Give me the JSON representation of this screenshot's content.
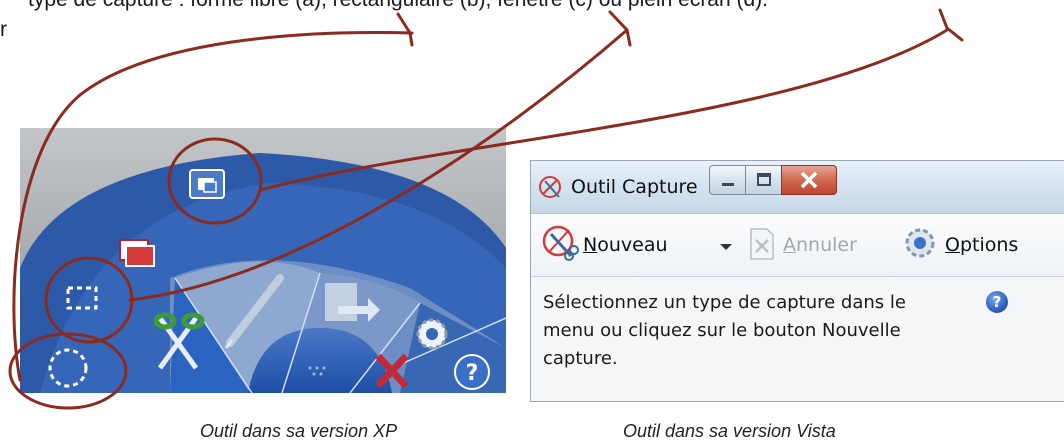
{
  "top_text": {
    "line": "type de capture : forme libre (a), rectangulaire (b), fenêtre (c) ou plein écran (d).",
    "r": "r"
  },
  "xp_tool": {
    "tool_buttons": [
      {
        "name": "free-form-capture-icon"
      },
      {
        "name": "rectangle-capture-icon"
      },
      {
        "name": "window-capture-icon"
      },
      {
        "name": "fullscreen-capture-icon"
      },
      {
        "name": "scissors-icon"
      },
      {
        "name": "pen-icon"
      },
      {
        "name": "send-icon"
      },
      {
        "name": "settings-gear-icon"
      },
      {
        "name": "delete-x-icon"
      },
      {
        "name": "help-icon"
      }
    ]
  },
  "vista_window": {
    "title": "Outil Capture",
    "toolbar": {
      "new_label_ul": "N",
      "new_label_rest": "ouveau",
      "cancel_label_ul": "A",
      "cancel_label_rest": "nnuler",
      "options_label_ul": "O",
      "options_label_rest": "ptions"
    },
    "message": "Sélectionnez un type de capture dans le menu ou cliquez sur le bouton Nouvelle capture.",
    "help_glyph": "?",
    "accent": "#c0442c"
  },
  "captions": {
    "xp": "Outil dans sa version XP",
    "vista": "Outil dans sa version Vista"
  },
  "colors": {
    "annotation": "#8b2a1e",
    "xp_blue": "#2a5db8",
    "vista_titlebar": "#d6e4f0"
  }
}
